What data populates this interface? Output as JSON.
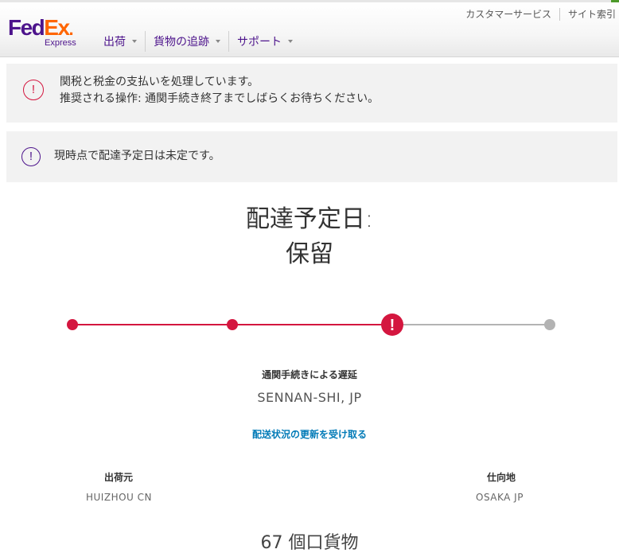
{
  "header": {
    "logo": {
      "fed": "Fed",
      "ex": "Ex",
      "sub": "Express"
    },
    "nav": [
      {
        "label": "出荷"
      },
      {
        "label": "貨物の追跡"
      },
      {
        "label": "サポート"
      }
    ],
    "utility": [
      {
        "label": "カスタマーサービス"
      },
      {
        "label": "サイト索引"
      }
    ]
  },
  "alerts": [
    {
      "icon": "!",
      "line1": "関税と税金の支払いを処理しています。",
      "line2": "推奨される操作: 通関手続き終了までしばらくお待ちください。",
      "color": "#d4163f"
    },
    {
      "icon": "!",
      "line1": "現時点で配達予定日は未定です。",
      "color": "#4d148c"
    }
  ],
  "delivery": {
    "label": "配達予定日:",
    "value": "保留"
  },
  "progress": {
    "steps_total": 4,
    "current_step": 3,
    "current_icon": "!",
    "active_color": "#d4163f",
    "inactive_color": "#b3b3b3"
  },
  "status": {
    "title": "通関手続きによる遅延",
    "location": "SENNAN-SHI, JP",
    "updates_link": "配送状況の更新を受け取る"
  },
  "shipment": {
    "from_label": "出荷元",
    "from_value": "HUIZHOU CN",
    "to_label": "仕向地",
    "to_value": "OSAKA JP",
    "pieces": "67 個口貨物"
  }
}
